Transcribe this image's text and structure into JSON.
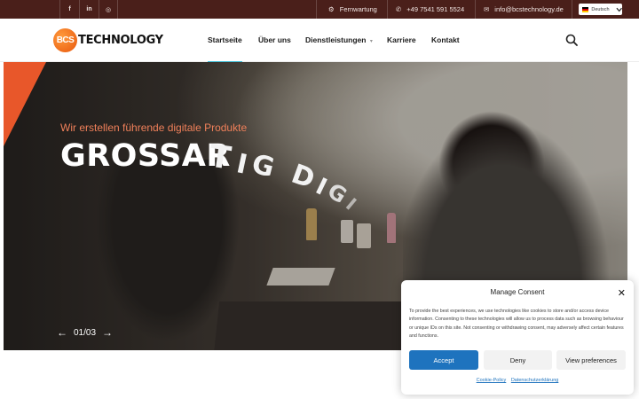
{
  "topbar": {
    "social": [
      {
        "icon": "facebook-icon",
        "glyph": "f"
      },
      {
        "icon": "linkedin-icon",
        "glyph": "in"
      },
      {
        "icon": "instagram-icon",
        "glyph": "◎"
      }
    ],
    "remote_label": "Fernwartung",
    "phone": "+49 7541 591 5524",
    "email": "info@bcstechnology.de",
    "language": "Deutsch",
    "background": "#4a1f1a"
  },
  "header": {
    "logo_mark": "BCS",
    "logo_word": "TECHNOLOGY",
    "nav": [
      {
        "label": "Startseite",
        "active": true
      },
      {
        "label": "Über uns"
      },
      {
        "label": "Dienstleistungen",
        "has_submenu": true
      },
      {
        "label": "Karriere"
      },
      {
        "label": "Kontakt"
      }
    ]
  },
  "hero": {
    "subtitle": "Wir erstellen führende digitale Produkte",
    "headline": "GROSSAR",
    "animated_letters": [
      "T",
      "I",
      "G",
      "D",
      "I",
      "G",
      "I"
    ],
    "slide_current": "01",
    "slide_total": "03",
    "accent": "#e8572a"
  },
  "consent": {
    "title": "Manage Consent",
    "text": "To provide the best experiences, we use technologies like cookies to store and/or access device information. Consenting to these technologies will allow us to process data such as browsing behaviour or unique IDs on this site. Not consenting or withdrawing consent, may adversely affect certain features and functions.",
    "accept_label": "Accept",
    "deny_label": "Deny",
    "preferences_label": "View preferences",
    "cookie_policy_label": "Cookie-Policy",
    "privacy_label": "Datenschutzerklärung",
    "accent": "#1e73be"
  }
}
